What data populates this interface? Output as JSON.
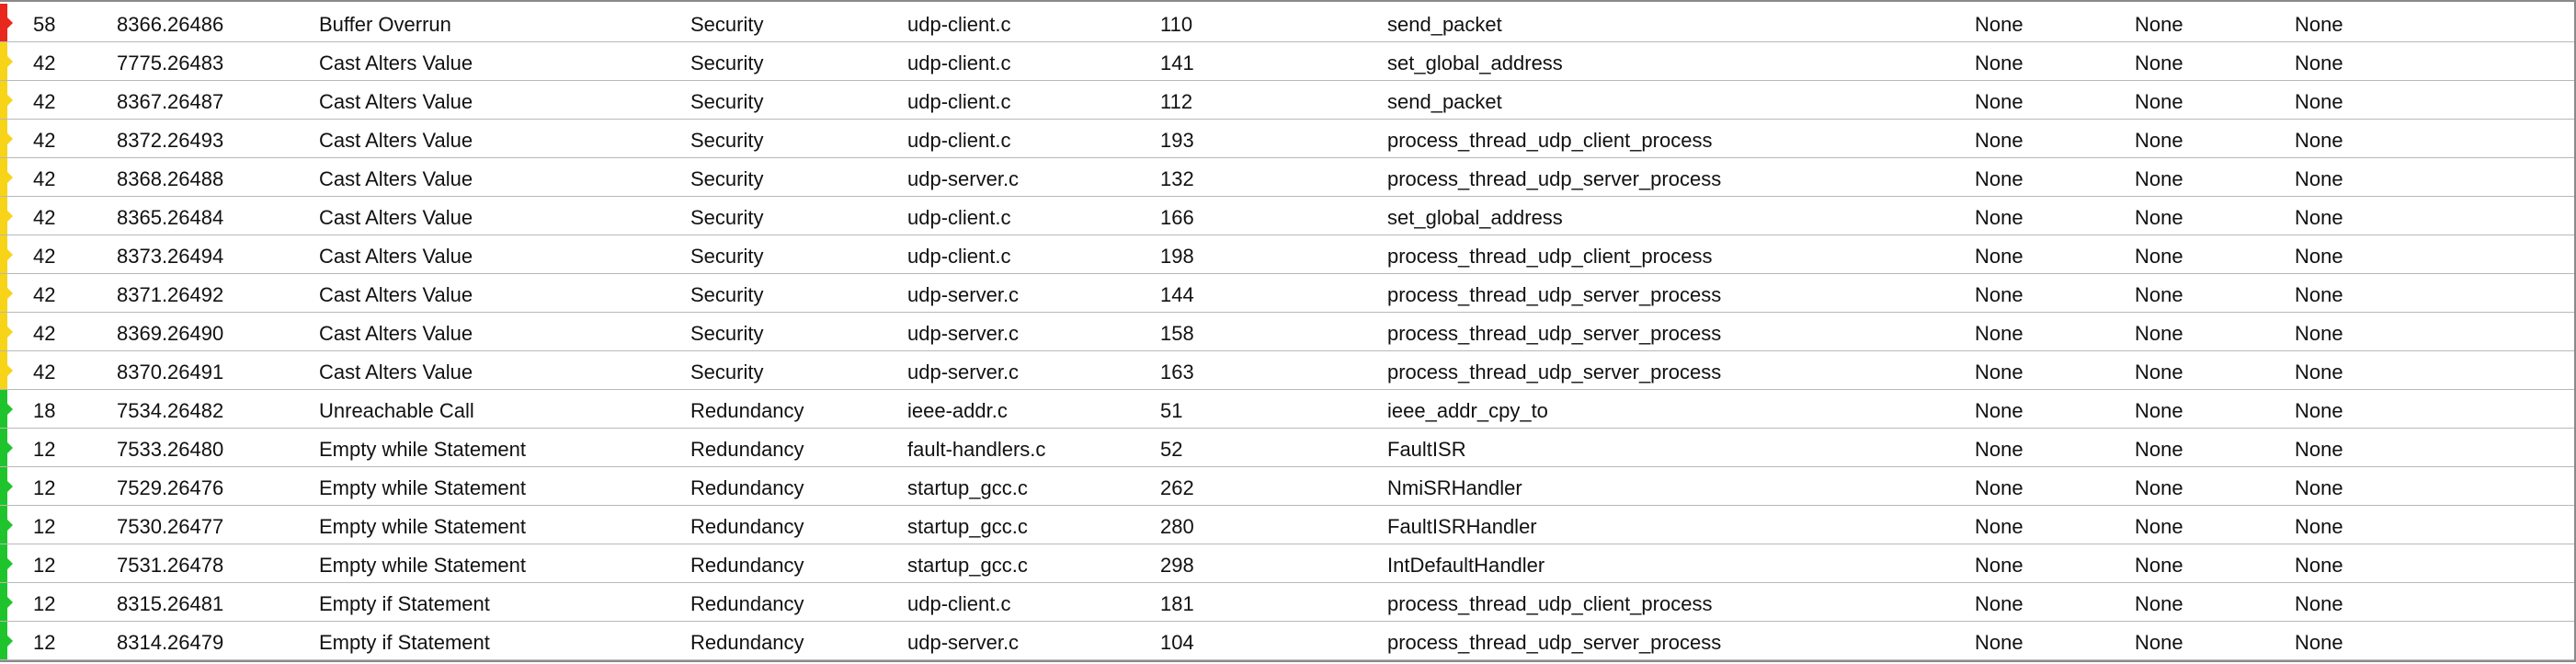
{
  "severity_colors": {
    "high": "#e8281e",
    "medium": "#f7d417",
    "low": "#1fc42c"
  },
  "findings": [
    {
      "severity": "high",
      "score": "58",
      "id": "8366.26486",
      "checker": "Buffer Overrun",
      "category": "Security",
      "file": "udp-client.c",
      "line": "110",
      "function": "send_packet",
      "c1": "None",
      "c2": "None",
      "c3": "None"
    },
    {
      "severity": "medium",
      "score": "42",
      "id": "7775.26483",
      "checker": "Cast Alters Value",
      "category": "Security",
      "file": "udp-client.c",
      "line": "141",
      "function": "set_global_address",
      "c1": "None",
      "c2": "None",
      "c3": "None"
    },
    {
      "severity": "medium",
      "score": "42",
      "id": "8367.26487",
      "checker": "Cast Alters Value",
      "category": "Security",
      "file": "udp-client.c",
      "line": "112",
      "function": "send_packet",
      "c1": "None",
      "c2": "None",
      "c3": "None"
    },
    {
      "severity": "medium",
      "score": "42",
      "id": "8372.26493",
      "checker": "Cast Alters Value",
      "category": "Security",
      "file": "udp-client.c",
      "line": "193",
      "function": "process_thread_udp_client_process",
      "c1": "None",
      "c2": "None",
      "c3": "None"
    },
    {
      "severity": "medium",
      "score": "42",
      "id": "8368.26488",
      "checker": "Cast Alters Value",
      "category": "Security",
      "file": "udp-server.c",
      "line": "132",
      "function": "process_thread_udp_server_process",
      "c1": "None",
      "c2": "None",
      "c3": "None"
    },
    {
      "severity": "medium",
      "score": "42",
      "id": "8365.26484",
      "checker": "Cast Alters Value",
      "category": "Security",
      "file": "udp-client.c",
      "line": "166",
      "function": "set_global_address",
      "c1": "None",
      "c2": "None",
      "c3": "None"
    },
    {
      "severity": "medium",
      "score": "42",
      "id": "8373.26494",
      "checker": "Cast Alters Value",
      "category": "Security",
      "file": "udp-client.c",
      "line": "198",
      "function": "process_thread_udp_client_process",
      "c1": "None",
      "c2": "None",
      "c3": "None"
    },
    {
      "severity": "medium",
      "score": "42",
      "id": "8371.26492",
      "checker": "Cast Alters Value",
      "category": "Security",
      "file": "udp-server.c",
      "line": "144",
      "function": "process_thread_udp_server_process",
      "c1": "None",
      "c2": "None",
      "c3": "None"
    },
    {
      "severity": "medium",
      "score": "42",
      "id": "8369.26490",
      "checker": "Cast Alters Value",
      "category": "Security",
      "file": "udp-server.c",
      "line": "158",
      "function": "process_thread_udp_server_process",
      "c1": "None",
      "c2": "None",
      "c3": "None"
    },
    {
      "severity": "medium",
      "score": "42",
      "id": "8370.26491",
      "checker": "Cast Alters Value",
      "category": "Security",
      "file": "udp-server.c",
      "line": "163",
      "function": "process_thread_udp_server_process",
      "c1": "None",
      "c2": "None",
      "c3": "None"
    },
    {
      "severity": "low",
      "score": "18",
      "id": "7534.26482",
      "checker": "Unreachable Call",
      "category": "Redundancy",
      "file": "ieee-addr.c",
      "line": "51",
      "function": "ieee_addr_cpy_to",
      "c1": "None",
      "c2": "None",
      "c3": "None"
    },
    {
      "severity": "low",
      "score": "12",
      "id": "7533.26480",
      "checker": "Empty while Statement",
      "category": "Redundancy",
      "file": "fault-handlers.c",
      "line": "52",
      "function": "FaultISR",
      "c1": "None",
      "c2": "None",
      "c3": "None"
    },
    {
      "severity": "low",
      "score": "12",
      "id": "7529.26476",
      "checker": "Empty while Statement",
      "category": "Redundancy",
      "file": "startup_gcc.c",
      "line": "262",
      "function": "NmiSRHandler",
      "c1": "None",
      "c2": "None",
      "c3": "None"
    },
    {
      "severity": "low",
      "score": "12",
      "id": "7530.26477",
      "checker": "Empty while Statement",
      "category": "Redundancy",
      "file": "startup_gcc.c",
      "line": "280",
      "function": "FaultISRHandler",
      "c1": "None",
      "c2": "None",
      "c3": "None"
    },
    {
      "severity": "low",
      "score": "12",
      "id": "7531.26478",
      "checker": "Empty while Statement",
      "category": "Redundancy",
      "file": "startup_gcc.c",
      "line": "298",
      "function": "IntDefaultHandler",
      "c1": "None",
      "c2": "None",
      "c3": "None"
    },
    {
      "severity": "low",
      "score": "12",
      "id": "8315.26481",
      "checker": "Empty if Statement",
      "category": "Redundancy",
      "file": "udp-client.c",
      "line": "181",
      "function": "process_thread_udp_client_process",
      "c1": "None",
      "c2": "None",
      "c3": "None"
    },
    {
      "severity": "low",
      "score": "12",
      "id": "8314.26479",
      "checker": "Empty if Statement",
      "category": "Redundancy",
      "file": "udp-server.c",
      "line": "104",
      "function": "process_thread_udp_server_process",
      "c1": "None",
      "c2": "None",
      "c3": "None"
    }
  ]
}
